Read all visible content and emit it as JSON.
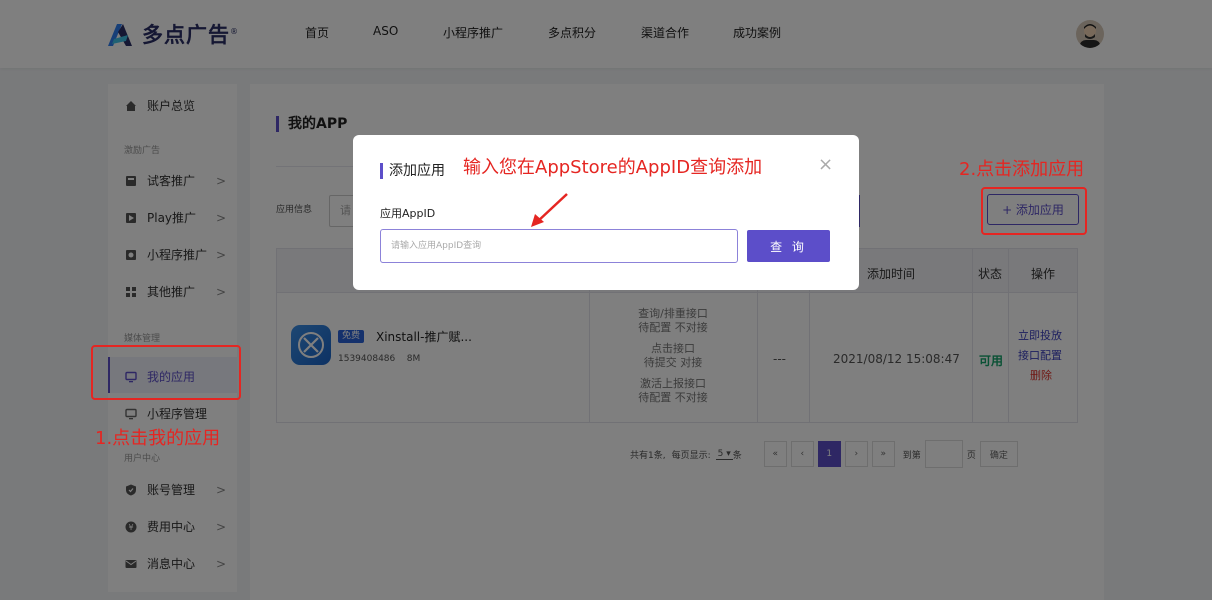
{
  "header": {
    "logo_text": "多点广告",
    "logo_mark": "®",
    "nav": [
      "首页",
      "ASO",
      "小程序推广",
      "多点积分",
      "渠道合作",
      "成功案例"
    ]
  },
  "sidebar": {
    "account_overview": "账户总览",
    "group_incentive": "激励广告",
    "incentive_items": [
      "试客推广",
      "Play推广",
      "小程序推广",
      "其他推广"
    ],
    "group_media": "媒体管理",
    "media_items": [
      "我的应用",
      "小程序管理"
    ],
    "group_user": "用户中心",
    "user_items": [
      "账号管理",
      "费用中心",
      "消息中心"
    ]
  },
  "main": {
    "title": "我的APP",
    "filter_label": "应用信息",
    "filter_placeholder_partial": "请",
    "add_button": "+ 添加应用",
    "table": {
      "headers": {
        "add_time": "添加时间",
        "status": "状态",
        "actions": "操作"
      },
      "row": {
        "badge": "免费",
        "app_name": "Xinstall-推广赋...",
        "app_id": "1539408486",
        "size": "8M",
        "api": [
          {
            "name": "查询/排重接口",
            "state": "待配置 不对接"
          },
          {
            "name": "点击接口",
            "state": "待提交 对接"
          },
          {
            "name": "激活上报接口",
            "state": "待配置 不对接"
          }
        ],
        "dash": "---",
        "add_time": "2021/08/12 15:08:47",
        "status": "可用",
        "actions": [
          "立即投放",
          "接口配置",
          "删除"
        ]
      }
    },
    "pagination": {
      "total": "共有1条,",
      "per_page_label": "每页显示:",
      "per_page_value": "5",
      "per_page_unit": "条",
      "first": "«",
      "prev": "‹",
      "current": "1",
      "next": "›",
      "last": "»",
      "goto_label": "到第",
      "goto_unit": "页",
      "confirm": "确定"
    }
  },
  "modal": {
    "title": "添加应用",
    "close": "×",
    "field_label": "应用AppID",
    "placeholder": "请输入应用AppID查询",
    "query_button": "查 询"
  },
  "annotations": {
    "step1": "1.点击我的应用",
    "step2": "2.点击添加应用",
    "hint": "输入您在AppStore的AppID查询添加"
  },
  "colors": {
    "accent": "#5c4ec9",
    "annotation_red": "#e52622",
    "status_green": "#14a36a",
    "delete_red": "#e0312a"
  }
}
